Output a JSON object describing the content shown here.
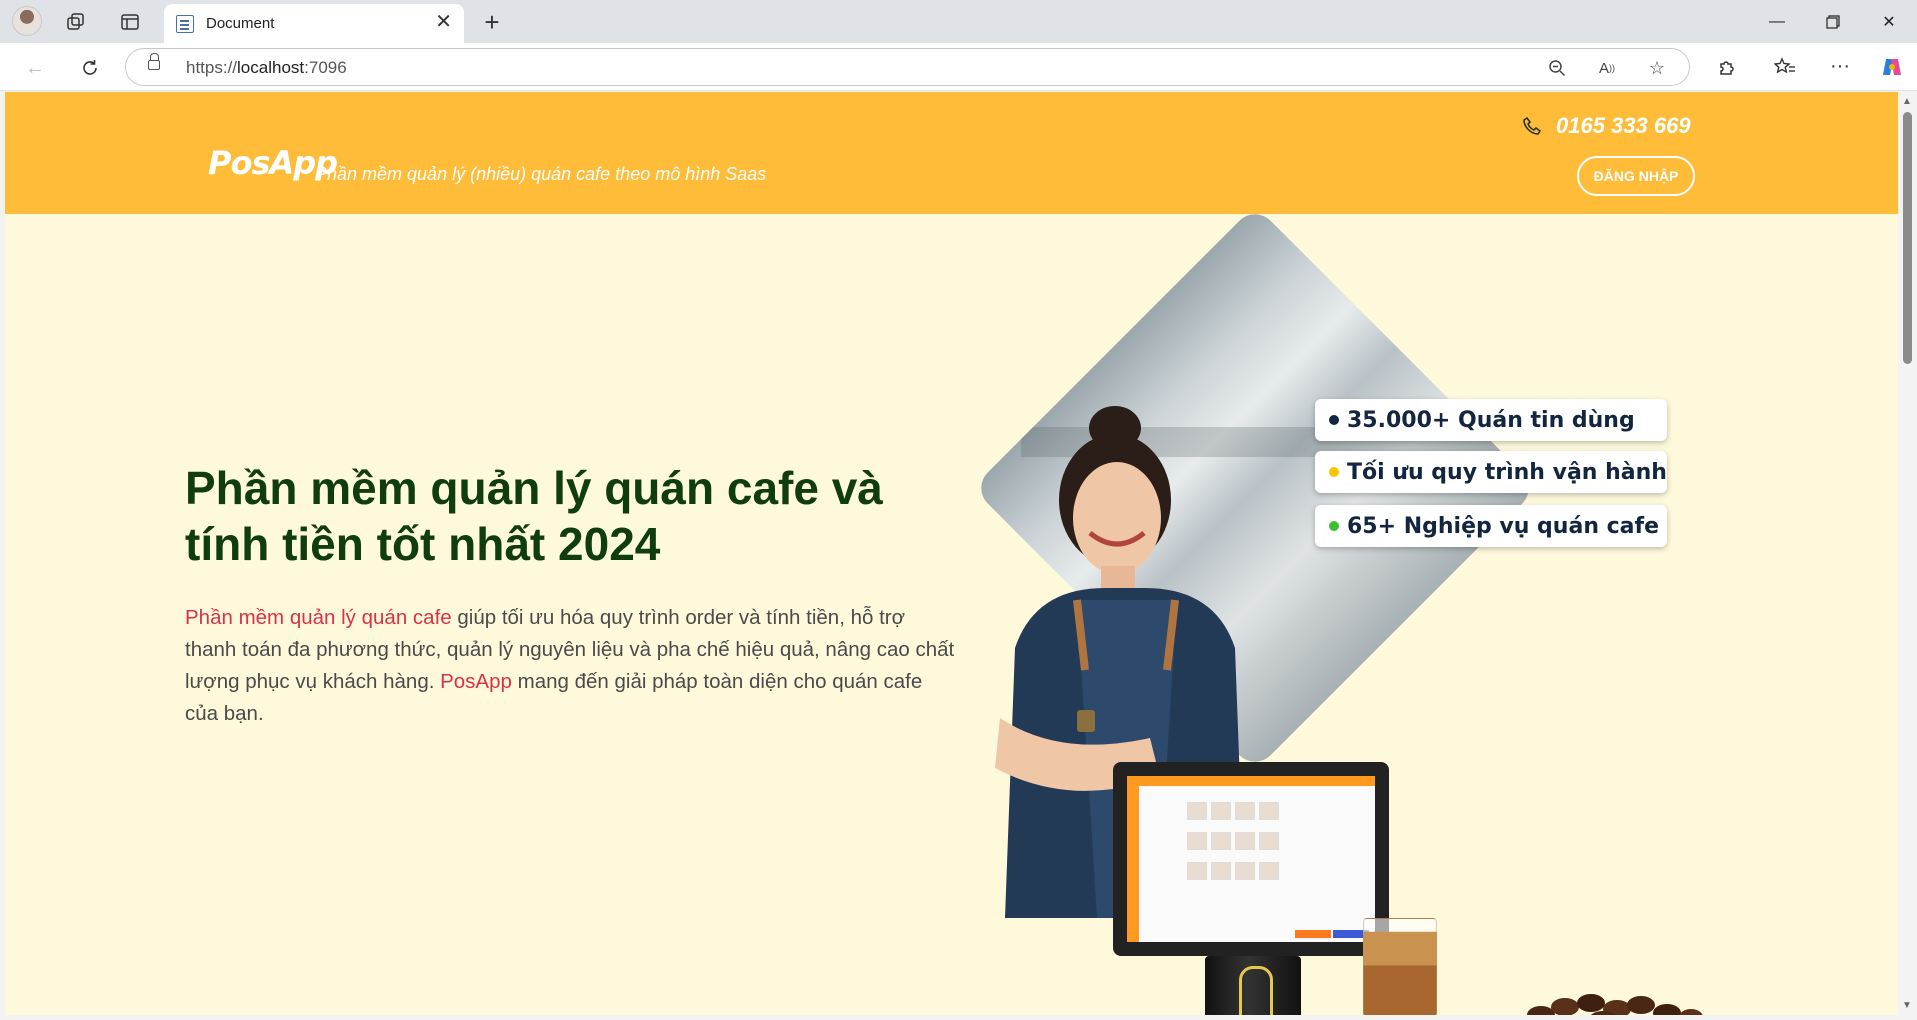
{
  "browser": {
    "tab_title": "Document",
    "url_scheme": "https://",
    "url_host": "localhost",
    "url_port": ":7096",
    "icons": [
      "profile-icon",
      "workspaces-icon",
      "tab-actions-icon",
      "close-icon",
      "new-tab-icon",
      "minimize-icon",
      "restore-icon",
      "close-window-icon",
      "back-icon",
      "refresh-icon",
      "lock-icon",
      "zoom-out-icon",
      "read-aloud-icon",
      "favorite-icon",
      "extensions-icon",
      "favorites-icon",
      "more-icon",
      "copilot-icon"
    ]
  },
  "header": {
    "logo": "PosApp",
    "tagline": "Phần mềm quản lý (nhiều) quán cafe theo mô hình Saas",
    "phone": "0165 333 669",
    "login_label": "ĐĂNG NHẬP",
    "brand_color": "#ffbc39"
  },
  "hero": {
    "title": "Phần mềm quản lý quán cafe và tính tiền tốt nhất 2024",
    "desc_link1": "Phần mềm quản lý quán cafe",
    "desc_part1": " giúp tối ưu hóa quy trình order và tính tiền, hỗ trợ thanh toán đa phương thức, quản lý nguyên liệu và pha chế hiệu quả, nâng cao chất lượng phục vụ khách hàng. ",
    "desc_link2": "PosApp",
    "desc_part2": " mang đến giải pháp toàn diện cho quán cafe của bạn.",
    "badges": [
      {
        "text": "35.000+ Quán tin dùng",
        "dot_color": "#13263f"
      },
      {
        "text": "Tối ưu quy trình vận hành",
        "dot_color": "#f5c400"
      },
      {
        "text": "65+ Nghiệp vụ quán cafe",
        "dot_color": "#3bbf2f"
      }
    ]
  }
}
